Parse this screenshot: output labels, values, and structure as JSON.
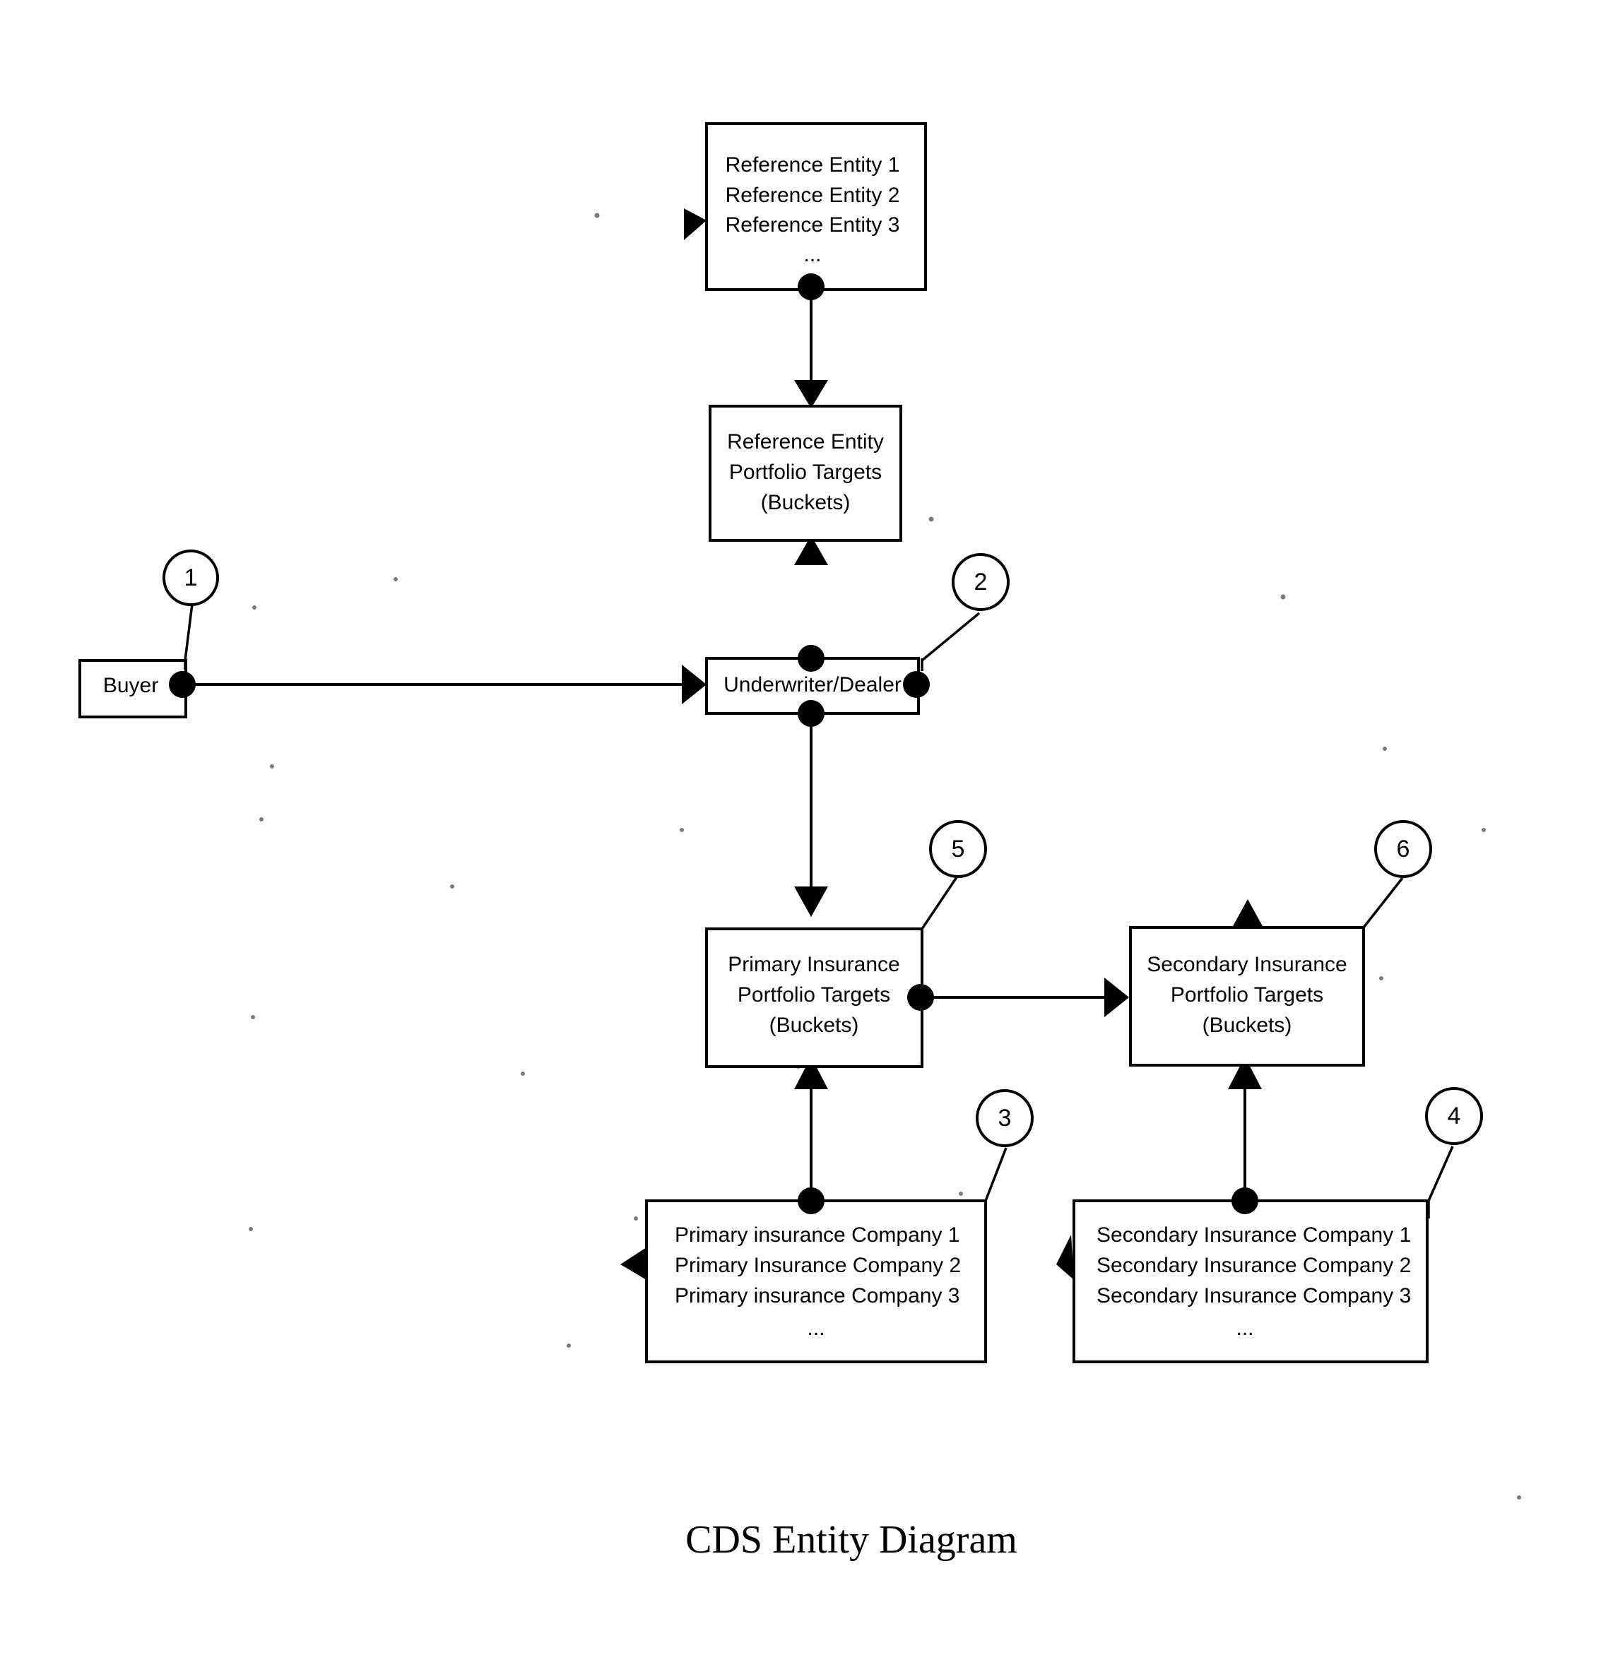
{
  "caption": "CDS Entity Diagram",
  "diagram": {
    "title": "CDS Entity Diagram",
    "type": "entity-relationship-flow"
  },
  "nodes": {
    "reference_entities": {
      "name": "reference-entities-list",
      "lines": [
        "Reference Entity 1",
        "Reference Entity 2",
        "Reference Entity 3"
      ],
      "ellipsis": "..."
    },
    "reference_entity_portfolio": {
      "name": "reference-entity-portfolio-targets",
      "lines": [
        "Reference Entity",
        "Portfolio Targets",
        "(Buckets)"
      ]
    },
    "buyer": {
      "name": "buyer",
      "label": "Buyer"
    },
    "underwriter": {
      "name": "underwriter-dealer",
      "label": "Underwriter/Dealer"
    },
    "primary_portfolio": {
      "name": "primary-insurance-portfolio-targets",
      "lines": [
        "Primary Insurance",
        "Portfolio Targets",
        "(Buckets)"
      ]
    },
    "secondary_portfolio": {
      "name": "secondary-insurance-portfolio-targets",
      "lines": [
        "Secondary Insurance",
        "Portfolio Targets",
        "(Buckets)"
      ]
    },
    "primary_companies": {
      "name": "primary-insurance-companies-list",
      "lines": [
        "Primary insurance Company 1",
        "Primary Insurance Company 2",
        "Primary insurance Company 3"
      ],
      "ellipsis": "..."
    },
    "secondary_companies": {
      "name": "secondary-insurance-companies-list",
      "lines": [
        "Secondary Insurance Company 1",
        "Secondary Insurance Company 2",
        "Secondary Insurance Company 3"
      ],
      "ellipsis": "..."
    }
  },
  "callouts": [
    {
      "id": "callout-1",
      "label": "1",
      "target": "buyer"
    },
    {
      "id": "callout-2",
      "label": "2",
      "target": "underwriter-dealer"
    },
    {
      "id": "callout-3",
      "label": "3",
      "target": "primary-insurance-companies-list"
    },
    {
      "id": "callout-4",
      "label": "4",
      "target": "secondary-insurance-companies-list"
    },
    {
      "id": "callout-5",
      "label": "5",
      "target": "primary-insurance-portfolio-targets"
    },
    {
      "id": "callout-6",
      "label": "6",
      "target": "secondary-insurance-portfolio-targets"
    }
  ],
  "connections": [
    {
      "from": "reference-entities-list",
      "to": "reference-entity-portfolio-targets",
      "direction": "down"
    },
    {
      "from": "underwriter-dealer",
      "to": "reference-entity-portfolio-targets",
      "direction": "up"
    },
    {
      "from": "buyer",
      "to": "underwriter-dealer",
      "direction": "right"
    },
    {
      "from": "underwriter-dealer",
      "to": "primary-insurance-portfolio-targets",
      "direction": "down"
    },
    {
      "from": "primary-insurance-portfolio-targets",
      "to": "secondary-insurance-portfolio-targets",
      "direction": "right"
    },
    {
      "from": "primary-insurance-companies-list",
      "to": "primary-insurance-portfolio-targets",
      "direction": "up"
    },
    {
      "from": "secondary-insurance-companies-list",
      "to": "secondary-insurance-portfolio-targets",
      "direction": "up"
    }
  ],
  "colors": {
    "stroke": "#000000",
    "fill": "#ffffff"
  }
}
